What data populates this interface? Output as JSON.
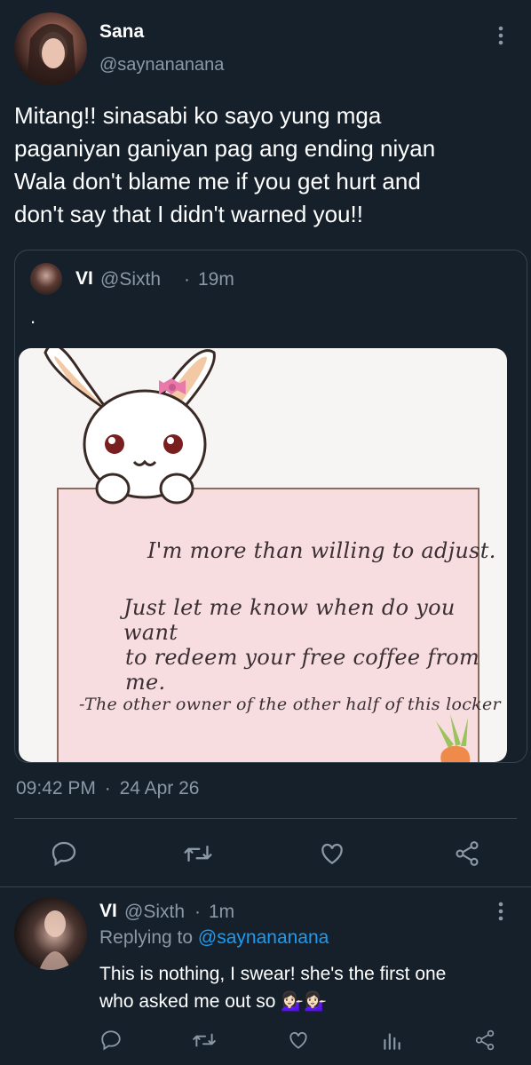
{
  "main_tweet": {
    "name": "Sana",
    "handle": "@saynananana",
    "text_lines": [
      "Mitang!! sinasabi ko sayo yung mga",
      "paganiyan ganiyan pag ang ending niyan",
      "Wala don't blame me if you get hurt and",
      "don't say that I didn't warned you!!"
    ],
    "time": "09:42 PM",
    "date": "24 Apr 26",
    "separator": "·"
  },
  "quoted_tweet": {
    "name": "VI",
    "handle": "@Sixth",
    "time": "19m",
    "text": ".",
    "image_text": [
      "I'm more than willing to adjust.",
      "Just let me know when do you want",
      "to redeem your free coffee from me.",
      "-The other owner of the other half of this locker"
    ]
  },
  "reply": {
    "name": "VI",
    "handle": "@Sixth",
    "time": "1m",
    "replying_prefix": "Replying to ",
    "replying_to": "@saynananana",
    "text_lines": [
      "This is nothing, I swear! she's the first one",
      "who asked me out so 💁🏻‍♀️💁🏻‍♀️"
    ]
  },
  "icons": [
    "more-icon",
    "reply-icon",
    "retweet-icon",
    "like-icon",
    "share-icon",
    "analytics-icon"
  ],
  "colors": {
    "background": "#15202b",
    "muted": "#8b98a5",
    "link": "#1d9bf0",
    "divider": "#38444d",
    "card_bg": "#f7f4f4",
    "note_bg": "#f8dde0"
  }
}
